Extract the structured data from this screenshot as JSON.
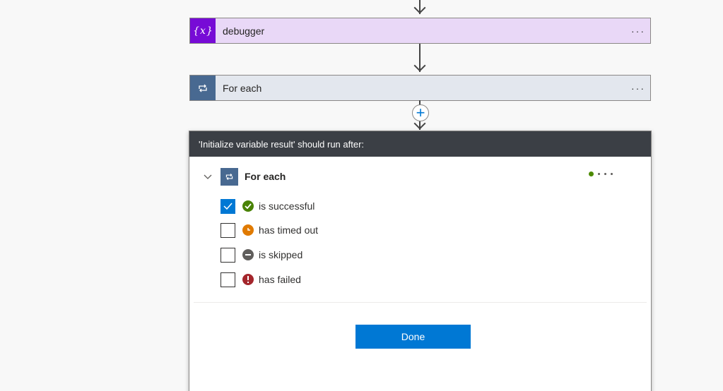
{
  "flow": {
    "steps": [
      {
        "id": "debugger",
        "title": "debugger",
        "icon": "variable-icon",
        "more": "···"
      },
      {
        "id": "foreach",
        "title": "For each",
        "icon": "loop-icon",
        "more": "···"
      }
    ],
    "add_button": "+"
  },
  "run_after_panel": {
    "header": "'Initialize variable result' should run after:",
    "group": {
      "title": "For each",
      "icon": "loop-icon",
      "expanded_icon": "chevron-down-icon"
    },
    "options": [
      {
        "label": "is successful",
        "checked": true,
        "icon": "success-icon",
        "color": "#498205"
      },
      {
        "label": "has timed out",
        "checked": false,
        "icon": "timeout-icon",
        "color": "#e07a00"
      },
      {
        "label": "is skipped",
        "checked": false,
        "icon": "skipped-icon",
        "color": "#605e5c"
      },
      {
        "label": "has failed",
        "checked": false,
        "icon": "failed-icon",
        "color": "#a4262c"
      }
    ],
    "done_label": "Done"
  },
  "colors": {
    "variable_accent": "#770bd6",
    "loop_accent": "#486991",
    "primary": "#0078d4",
    "panel_header": "#3b3f45"
  }
}
